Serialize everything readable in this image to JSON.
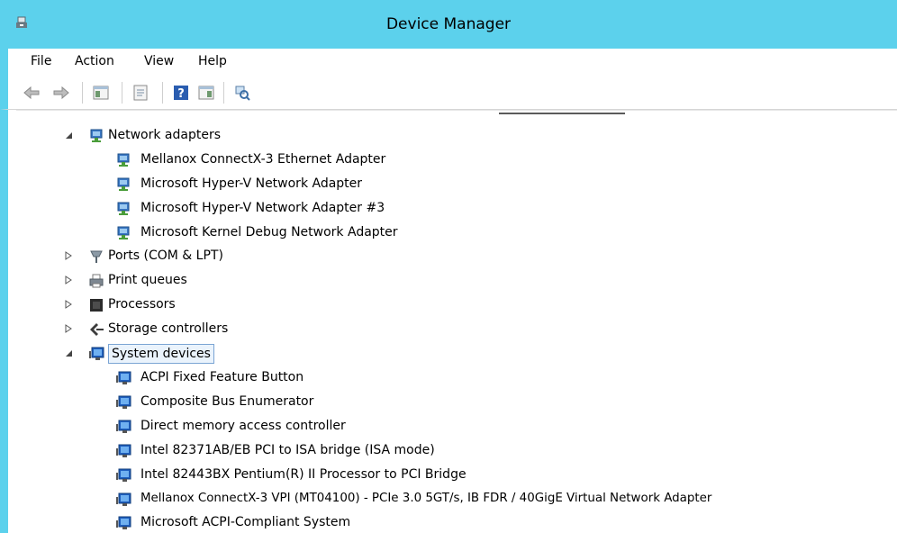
{
  "window": {
    "title": "Device Manager",
    "accent": "#5cd1ec"
  },
  "menu": {
    "items": [
      "File",
      "Action",
      "View",
      "Help"
    ]
  },
  "toolbar": {
    "buttons": [
      "back-arrow-icon",
      "forward-arrow-icon",
      "show-hide-console-tree-icon",
      "properties-icon",
      "help-icon",
      "action-pane-icon",
      "scan-hardware-icon"
    ]
  },
  "tree": {
    "network": {
      "label": "Network adapters",
      "items": [
        "Mellanox ConnectX-3 Ethernet Adapter",
        "Microsoft Hyper-V Network Adapter",
        "Microsoft Hyper-V Network Adapter #3",
        "Microsoft Kernel Debug Network Adapter"
      ]
    },
    "ports": {
      "label": "Ports (COM & LPT)"
    },
    "print": {
      "label": "Print queues"
    },
    "processors": {
      "label": "Processors"
    },
    "storage": {
      "label": "Storage controllers"
    },
    "system": {
      "label": "System devices",
      "items": [
        "ACPI Fixed Feature Button",
        "Composite Bus Enumerator",
        "Direct memory access controller",
        "Intel 82371AB/EB PCI to ISA bridge (ISA mode)",
        "Intel 82443BX Pentium(R) II Processor to PCI Bridge",
        "Mellanox ConnectX-3 VPI (MT04100) - PCIe 3.0 5GT/s, IB FDR / 40GigE Virtual Network Adapter",
        "Microsoft ACPI-Compliant System"
      ]
    }
  }
}
